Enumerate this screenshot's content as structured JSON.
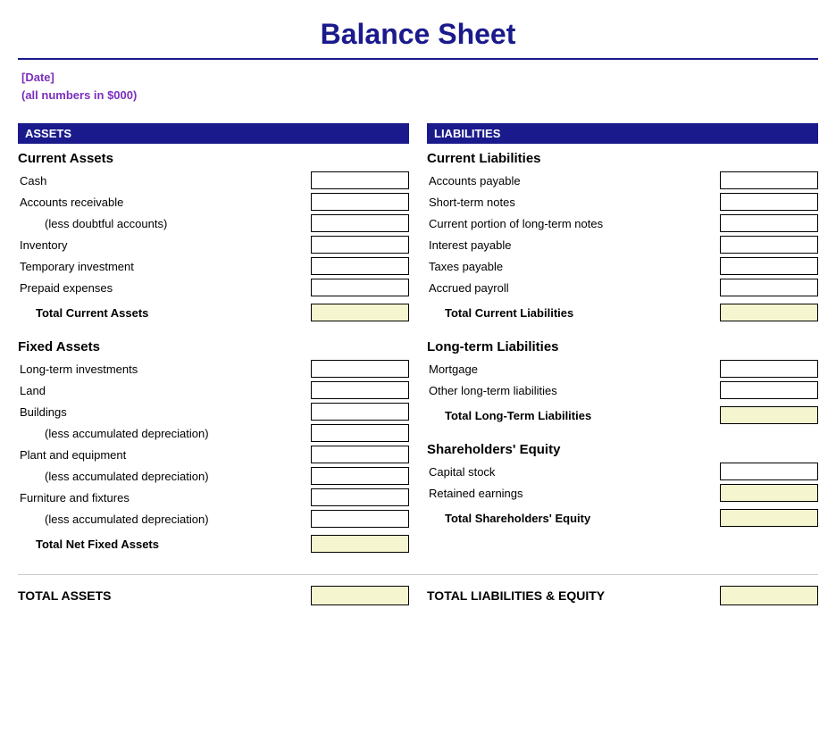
{
  "title": "Balance Sheet",
  "date": "[Date]",
  "subtitle": "(all numbers in $000)",
  "assets": {
    "header": "ASSETS",
    "current": {
      "title": "Current Assets",
      "items": [
        {
          "label": "Cash",
          "indented": false
        },
        {
          "label": "Accounts receivable",
          "indented": false
        },
        {
          "label": "(less doubtful accounts)",
          "indented": true
        },
        {
          "label": "Inventory",
          "indented": false
        },
        {
          "label": "Temporary investment",
          "indented": false
        },
        {
          "label": "Prepaid expenses",
          "indented": false
        }
      ],
      "total": "Total Current Assets"
    },
    "fixed": {
      "title": "Fixed Assets",
      "items": [
        {
          "label": "Long-term investments",
          "indented": false
        },
        {
          "label": "Land",
          "indented": false
        },
        {
          "label": "Buildings",
          "indented": false
        },
        {
          "label": "(less accumulated depreciation)",
          "indented": true
        },
        {
          "label": "Plant and equipment",
          "indented": false
        },
        {
          "label": "(less accumulated depreciation)",
          "indented": true
        },
        {
          "label": "Furniture and fixtures",
          "indented": false
        },
        {
          "label": "(less accumulated depreciation)",
          "indented": true
        }
      ],
      "total": "Total Net Fixed Assets"
    },
    "total_label": "TOTAL ASSETS"
  },
  "liabilities": {
    "header": "LIABILITIES",
    "current": {
      "title": "Current Liabilities",
      "items": [
        {
          "label": "Accounts payable",
          "indented": false
        },
        {
          "label": "Short-term notes",
          "indented": false
        },
        {
          "label": "Current portion of long-term notes",
          "indented": false
        },
        {
          "label": "Interest payable",
          "indented": false
        },
        {
          "label": "Taxes payable",
          "indented": false
        },
        {
          "label": "Accrued payroll",
          "indented": false
        }
      ],
      "total": "Total Current Liabilities"
    },
    "longterm": {
      "title": "Long-term Liabilities",
      "items": [
        {
          "label": "Mortgage",
          "indented": false
        },
        {
          "label": "Other long-term liabilities",
          "indented": false
        }
      ],
      "total": "Total Long-Term Liabilities"
    },
    "equity": {
      "title": "Shareholders' Equity",
      "items": [
        {
          "label": "Capital stock",
          "indented": false
        },
        {
          "label": "Retained earnings",
          "indented": false
        }
      ],
      "total": "Total Shareholders' Equity"
    },
    "total_label": "TOTAL LIABILITIES & EQUITY"
  }
}
